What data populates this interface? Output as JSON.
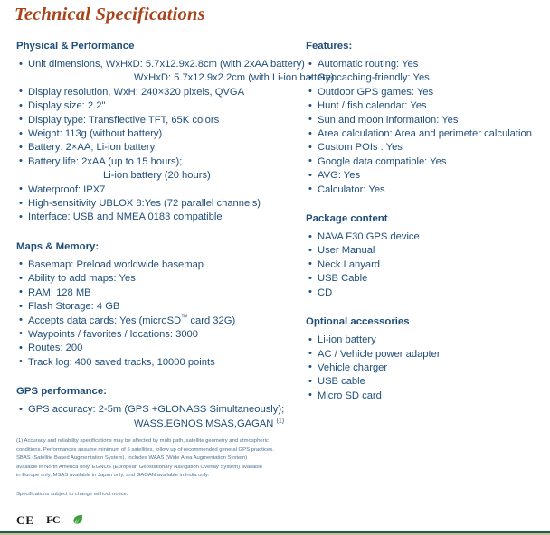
{
  "document": {
    "title": "Technical Specifications",
    "disclaimer": "Specifications subject to change without notice."
  },
  "colors": {
    "title": "#a8441c",
    "body": "#1f4e79",
    "footnote": "#4a7397",
    "rule": "#1d5c52"
  },
  "left_column": [
    {
      "heading": "Physical & Performance",
      "items": [
        {
          "text": "Unit dimensions, WxHxD: 5.7x12.9x2.8cm (with 2xAA battery)",
          "bullet": true
        },
        {
          "text": "WxHxD: 5.7x12.9x2.2cm (with Li-ion battery)",
          "bullet": false,
          "indent": "wide"
        },
        {
          "text": "Display resolution, WxH:   240×320 pixels, QVGA",
          "bullet": true
        },
        {
          "text": "Display size:   2.2\"",
          "bullet": true
        },
        {
          "text": "Display type:  Transflective TFT, 65K colors",
          "bullet": true
        },
        {
          "text": "Weight:  113g (without battery)",
          "bullet": true
        },
        {
          "text": "Battery:  2×AA; Li-ion battery",
          "bullet": true
        },
        {
          "text": "Battery life:  2xAA (up to 15 hours);",
          "bullet": true
        },
        {
          "text": "Li-ion battery (20 hours)",
          "bullet": false,
          "indent": "normal"
        },
        {
          "text": "Waterproof:  IPX7",
          "bullet": true
        },
        {
          "text": "High-sensitivity UBLOX 8:Yes (72 parallel channels)",
          "bullet": true
        },
        {
          "text": "Interface:  USB and NMEA 0183 compatible",
          "bullet": true
        }
      ]
    },
    {
      "heading": "Maps & Memory:",
      "items": [
        {
          "text": "Basemap:   Preload worldwide basemap",
          "bullet": true
        },
        {
          "text": "Ability to add maps:   Yes",
          "bullet": true
        },
        {
          "text": "RAM:   128 MB",
          "bullet": true
        },
        {
          "text": "Flash Storage:   4 GB",
          "bullet": true
        },
        {
          "text": "Accepts data cards:   Yes (microSD™ card 32G)",
          "bullet": true,
          "has_tm": true
        },
        {
          "text": "Waypoints / favorites / locations:  3000",
          "bullet": true
        },
        {
          "text": "Routes:  200",
          "bullet": true
        },
        {
          "text": "Track log: 400 saved tracks, 10000 points",
          "bullet": true
        }
      ]
    },
    {
      "heading": "GPS performance:",
      "items": [
        {
          "text": "GPS accuracy: 2-5m (GPS +GLONASS Simultaneously);",
          "bullet": true
        },
        {
          "text": "WASS,EGNOS,MSAS,GAGAN",
          "bullet": false,
          "indent": "wide",
          "has_footnote": true
        }
      ]
    }
  ],
  "right_column": [
    {
      "heading": "Features:",
      "items": [
        {
          "text": "Automatic routing:  Yes",
          "bullet": true
        },
        {
          "text": "Geocaching-friendly:  Yes",
          "bullet": true
        },
        {
          "text": "Outdoor GPS games:  Yes",
          "bullet": true
        },
        {
          "text": "Hunt / fish calendar:  Yes",
          "bullet": true
        },
        {
          "text": "Sun and moon information:  Yes",
          "bullet": true
        },
        {
          "text": "Area calculation:  Area and perimeter calculation",
          "bullet": true
        },
        {
          "text": "Custom POIs :  Yes",
          "bullet": true
        },
        {
          "text": "Google data compatible: Yes",
          "bullet": true
        },
        {
          "text": "AVG:  Yes",
          "bullet": true
        },
        {
          "text": "Calculator:  Yes",
          "bullet": true
        }
      ]
    },
    {
      "heading": "Package content",
      "items": [
        {
          "text": "NAVA F30 GPS device",
          "bullet": true
        },
        {
          "text": "User Manual",
          "bullet": true
        },
        {
          "text": "Neck Lanyard",
          "bullet": true
        },
        {
          "text": "USB Cable",
          "bullet": true
        },
        {
          "text": "CD",
          "bullet": true
        }
      ]
    },
    {
      "heading": "Optional accessories",
      "items": [
        {
          "text": "Li-ion battery",
          "bullet": true
        },
        {
          "text": "AC / Vehicle power adapter",
          "bullet": true
        },
        {
          "text": "Vehicle charger",
          "bullet": true
        },
        {
          "text": "USB cable",
          "bullet": true
        },
        {
          "text": "Micro SD card",
          "bullet": true
        }
      ]
    }
  ],
  "footnote": {
    "lines": [
      "(1) Accuracy and reliability specifications may be affected by multi path, satellite geometry and atmospheric",
      "conditions. Performances assume minimum of 5 satellites, follow up of recommended general GPS practices.",
      "SBAS (Satellite Based Augmentation System). Includes WAAS (Wide Area Augmentation System)",
      "available in North America only, EGNOS (European Geostationary Navigation Overlay System) available",
      "in Europe only, MSAS available in Japan only, and GAGAN available in India only."
    ]
  },
  "certification_marks": [
    {
      "name": "ce-mark",
      "label": "CE"
    },
    {
      "name": "fcc-mark",
      "label": "FC"
    },
    {
      "name": "rohs-leaf-mark",
      "label": ""
    }
  ]
}
